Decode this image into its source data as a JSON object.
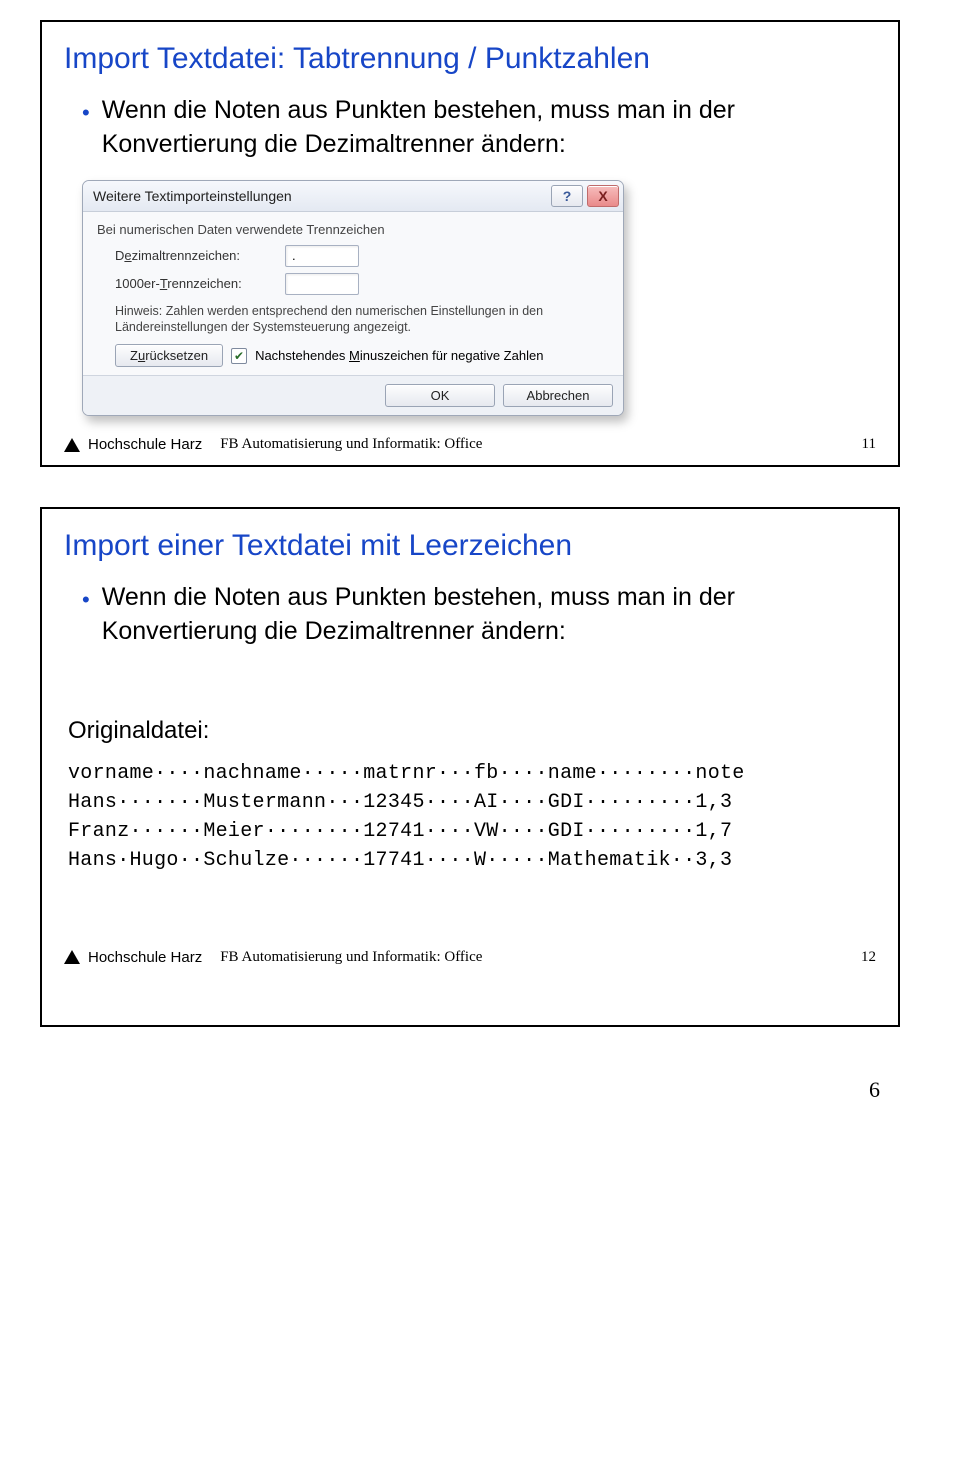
{
  "slide1": {
    "title": "Import Textdatei: Tabtrennung / Punktzahlen",
    "bullet": "Wenn die Noten aus Punkten bestehen, muss man in der Konvertierung die Dezimaltrenner ändern:",
    "dialog": {
      "title": "Weitere Textimporteinstellungen",
      "help": "?",
      "close": "X",
      "group": "Bei numerischen Daten verwendete Trennzeichen",
      "dec_label_pre": "D",
      "dec_label_ul": "e",
      "dec_label_post": "zimaltrennzeichen:",
      "dec_value": ".",
      "thou_label_pre": "1000er-",
      "thou_label_ul": "T",
      "thou_label_post": "rennzeichen:",
      "thou_value": "",
      "hint": "Hinweis: Zahlen werden entsprechend den numerischen Einstellungen in den Ländereinstellungen der Systemsteuerung angezeigt.",
      "reset_pre": "Z",
      "reset_ul": "u",
      "reset_post": "rücksetzen",
      "chk_pre": "Nachstehendes ",
      "chk_ul": "M",
      "chk_post": "inuszeichen für negative Zahlen",
      "ok": "OK",
      "cancel": "Abbrechen"
    },
    "footer_brand": "Hochschule Harz",
    "footer_mid": "FB Automatisierung und Informatik: Office",
    "footer_page": "11"
  },
  "slide2": {
    "title": "Import einer Textdatei mit Leerzeichen",
    "bullet": "Wenn die Noten aus Punkten bestehen, muss man in der Konvertierung die Dezimaltrenner ändern:",
    "subheading": "Originaldatei:",
    "mono": "vorname····nachname·····matrnr···fb····name········note\nHans·······Mustermann···12345····AI····GDI·········1,3\nFranz······Meier········12741····VW····GDI·········1,7\nHans·Hugo··Schulze······17741····W·····Mathematik··3,3",
    "footer_brand": "Hochschule Harz",
    "footer_mid": "FB Automatisierung und Informatik: Office",
    "footer_page": "12"
  },
  "page_number": "6"
}
